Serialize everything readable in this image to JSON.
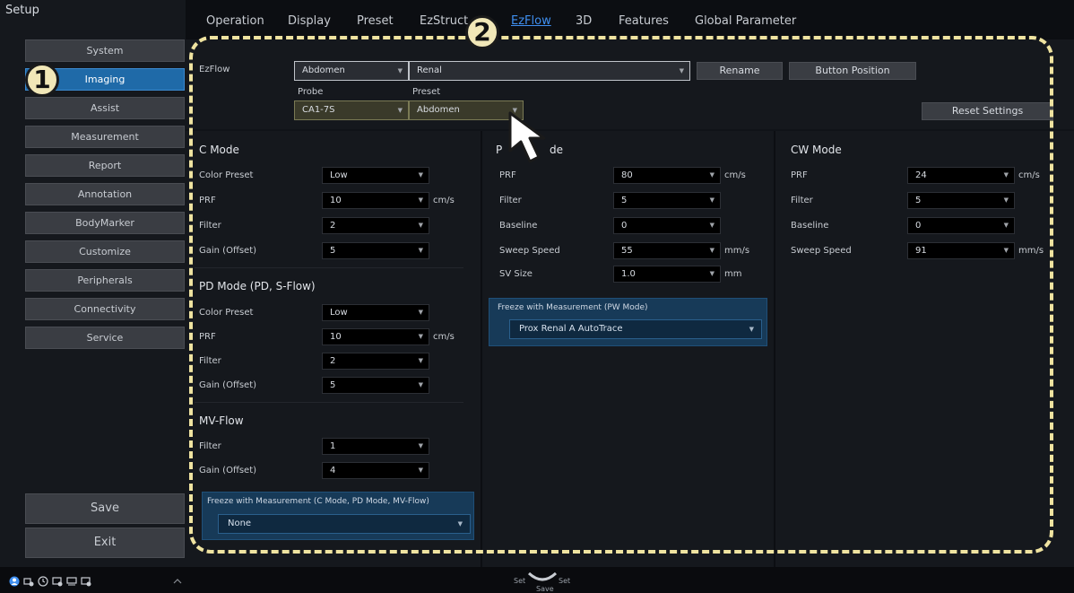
{
  "sidebar": {
    "title": "Setup",
    "items": [
      {
        "label": "System"
      },
      {
        "label": "Imaging"
      },
      {
        "label": "Assist"
      },
      {
        "label": "Measurement"
      },
      {
        "label": "Report"
      },
      {
        "label": "Annotation"
      },
      {
        "label": "BodyMarker"
      },
      {
        "label": "Customize"
      },
      {
        "label": "Peripherals"
      },
      {
        "label": "Connectivity"
      },
      {
        "label": "Service"
      }
    ],
    "save_label": "Save",
    "exit_label": "Exit"
  },
  "tabs": [
    "Operation",
    "Display",
    "Preset",
    "EzStruct",
    "EzFlow",
    "3D",
    "Features",
    "Global Parameter"
  ],
  "active_tab": "EzFlow",
  "ezflow": {
    "label": "EzFlow",
    "application": "Abdomen",
    "name": "Renal",
    "rename_label": "Rename",
    "button_position_label": "Button Position",
    "probe_label": "Probe",
    "probe_value": "CA1-7S",
    "preset_label": "Preset",
    "preset_value": "Abdomen",
    "reset_label": "Reset Settings"
  },
  "c_mode": {
    "title": "C Mode",
    "rows": [
      {
        "label": "Color Preset",
        "value": "Low",
        "unit": ""
      },
      {
        "label": "PRF",
        "value": "10",
        "unit": "cm/s"
      },
      {
        "label": "Filter",
        "value": "2",
        "unit": ""
      },
      {
        "label": "Gain (Offset)",
        "value": "5",
        "unit": ""
      }
    ]
  },
  "pd_mode": {
    "title": "PD Mode (PD, S-Flow)",
    "rows": [
      {
        "label": "Color Preset",
        "value": "Low",
        "unit": ""
      },
      {
        "label": "PRF",
        "value": "10",
        "unit": "cm/s"
      },
      {
        "label": "Filter",
        "value": "2",
        "unit": ""
      },
      {
        "label": "Gain (Offset)",
        "value": "5",
        "unit": ""
      }
    ]
  },
  "mv_flow": {
    "title": "MV-Flow",
    "rows": [
      {
        "label": "Filter",
        "value": "1",
        "unit": ""
      },
      {
        "label": "Gain (Offset)",
        "value": "4",
        "unit": ""
      }
    ]
  },
  "freeze_c": {
    "title": "Freeze with Measurement (C Mode, PD Mode, MV-Flow)",
    "value": "None"
  },
  "pw_mode": {
    "title_start": "P",
    "title_end": "de",
    "rows": [
      {
        "label": "PRF",
        "value": "80",
        "unit": "cm/s"
      },
      {
        "label": "Filter",
        "value": "5",
        "unit": ""
      },
      {
        "label": "Baseline",
        "value": "0",
        "unit": ""
      },
      {
        "label": "Sweep Speed",
        "value": "55",
        "unit": "mm/s"
      },
      {
        "label": "SV Size",
        "value": "1.0",
        "unit": "mm"
      }
    ]
  },
  "freeze_pw": {
    "title": "Freeze with Measurement (PW Mode)",
    "value": "Prox Renal A AutoTrace"
  },
  "cw_mode": {
    "title": "CW Mode",
    "rows": [
      {
        "label": "PRF",
        "value": "24",
        "unit": "cm/s"
      },
      {
        "label": "Filter",
        "value": "5",
        "unit": ""
      },
      {
        "label": "Baseline",
        "value": "0",
        "unit": ""
      },
      {
        "label": "Sweep Speed",
        "value": "91",
        "unit": "mm/s"
      }
    ]
  },
  "badges": [
    "1",
    "2"
  ],
  "bottom": {
    "set_left": "Set",
    "set_right": "Set",
    "save": "Save"
  },
  "colors": {
    "accent": "#1f6aa8",
    "tab_active": "#3f8ff0",
    "highlight": "#efe3a0"
  }
}
